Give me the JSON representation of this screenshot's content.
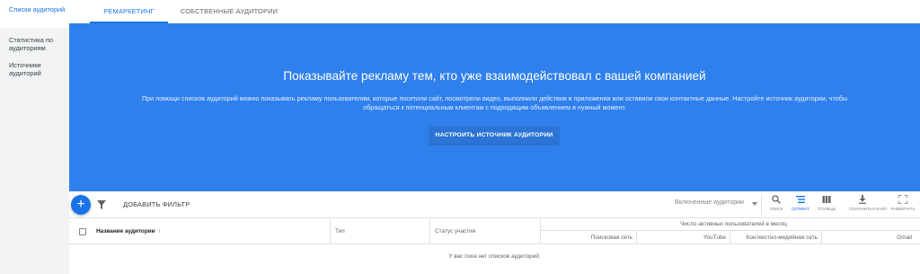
{
  "sidebar": {
    "items": [
      {
        "label": "Списки аудиторий",
        "active": true
      },
      {
        "label": "Статистика по аудиториям",
        "active": false
      },
      {
        "label": "Источники аудиторий",
        "active": false
      }
    ]
  },
  "tabs": [
    {
      "label": "РЕМАРКЕТИНГ",
      "active": true
    },
    {
      "label": "СОБСТВЕННЫЕ АУДИТОРИИ",
      "active": false
    }
  ],
  "hero": {
    "title": "Показывайте рекламу тем, кто уже взаимодействовал с вашей компанией",
    "description": "При помощи списков аудиторий можно показывать рекламу пользователям, которые посетили сайт, посмотрели видео, выполнили действия в приложении или оставили свои контактные данные. Настройте источник аудитории, чтобы обращаться к потенциальным клиентам с подходящим объявлением в нужный момент.",
    "button_label": "НАСТРОИТЬ ИСТОЧНИК АУДИТОРИИ",
    "background_color": "#2f80ec"
  },
  "toolbar": {
    "fab_icon": "plus-icon",
    "add_filter_label": "ДОБАВИТЬ ФИЛЬТР",
    "select_value": "Включенные аудитории",
    "tools": [
      {
        "name": "search",
        "icon": "search-icon",
        "label": "ПОИСК",
        "active": false
      },
      {
        "name": "segment",
        "icon": "segment-icon",
        "label": "СЕГМЕНТ",
        "active": true
      },
      {
        "name": "columns",
        "icon": "columns-icon",
        "label": "СТОЛБЦЫ",
        "active": false
      },
      {
        "name": "download",
        "icon": "download-icon",
        "label": "СОХРАНИТЬ В ФАЙЛ",
        "active": false
      },
      {
        "name": "expand",
        "icon": "expand-icon",
        "label": "РАЗВЕРНУТЬ",
        "active": false
      }
    ]
  },
  "table": {
    "columns": {
      "name": "Название аудитории",
      "type": "Тип",
      "status": "Статус участия"
    },
    "group_header": "Число активных пользователей в месяц",
    "sub_columns": [
      "Поисковая сеть",
      "YouTube",
      "Контекстно-медийная сеть",
      "Gmail"
    ],
    "empty_message": "У вас пока нет списков аудиторий."
  },
  "accent_color": "#1a73e8"
}
